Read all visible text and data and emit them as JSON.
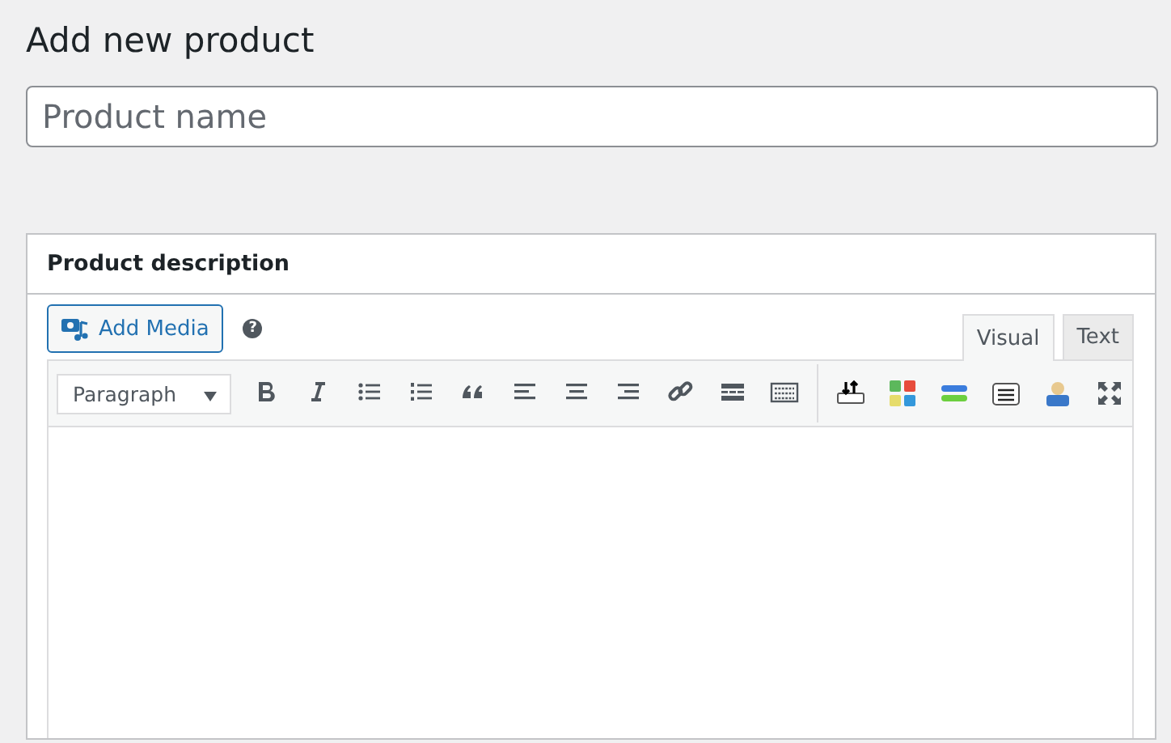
{
  "page_title": "Add new product",
  "product_name": {
    "placeholder": "Product name"
  },
  "description_panel": {
    "title": "Product description",
    "add_media": "Add Media",
    "help": "?",
    "tabs": [
      {
        "label": "Visual",
        "selected": true
      },
      {
        "label": "Text",
        "selected": false
      }
    ],
    "format_select": {
      "value": "Paragraph"
    }
  }
}
